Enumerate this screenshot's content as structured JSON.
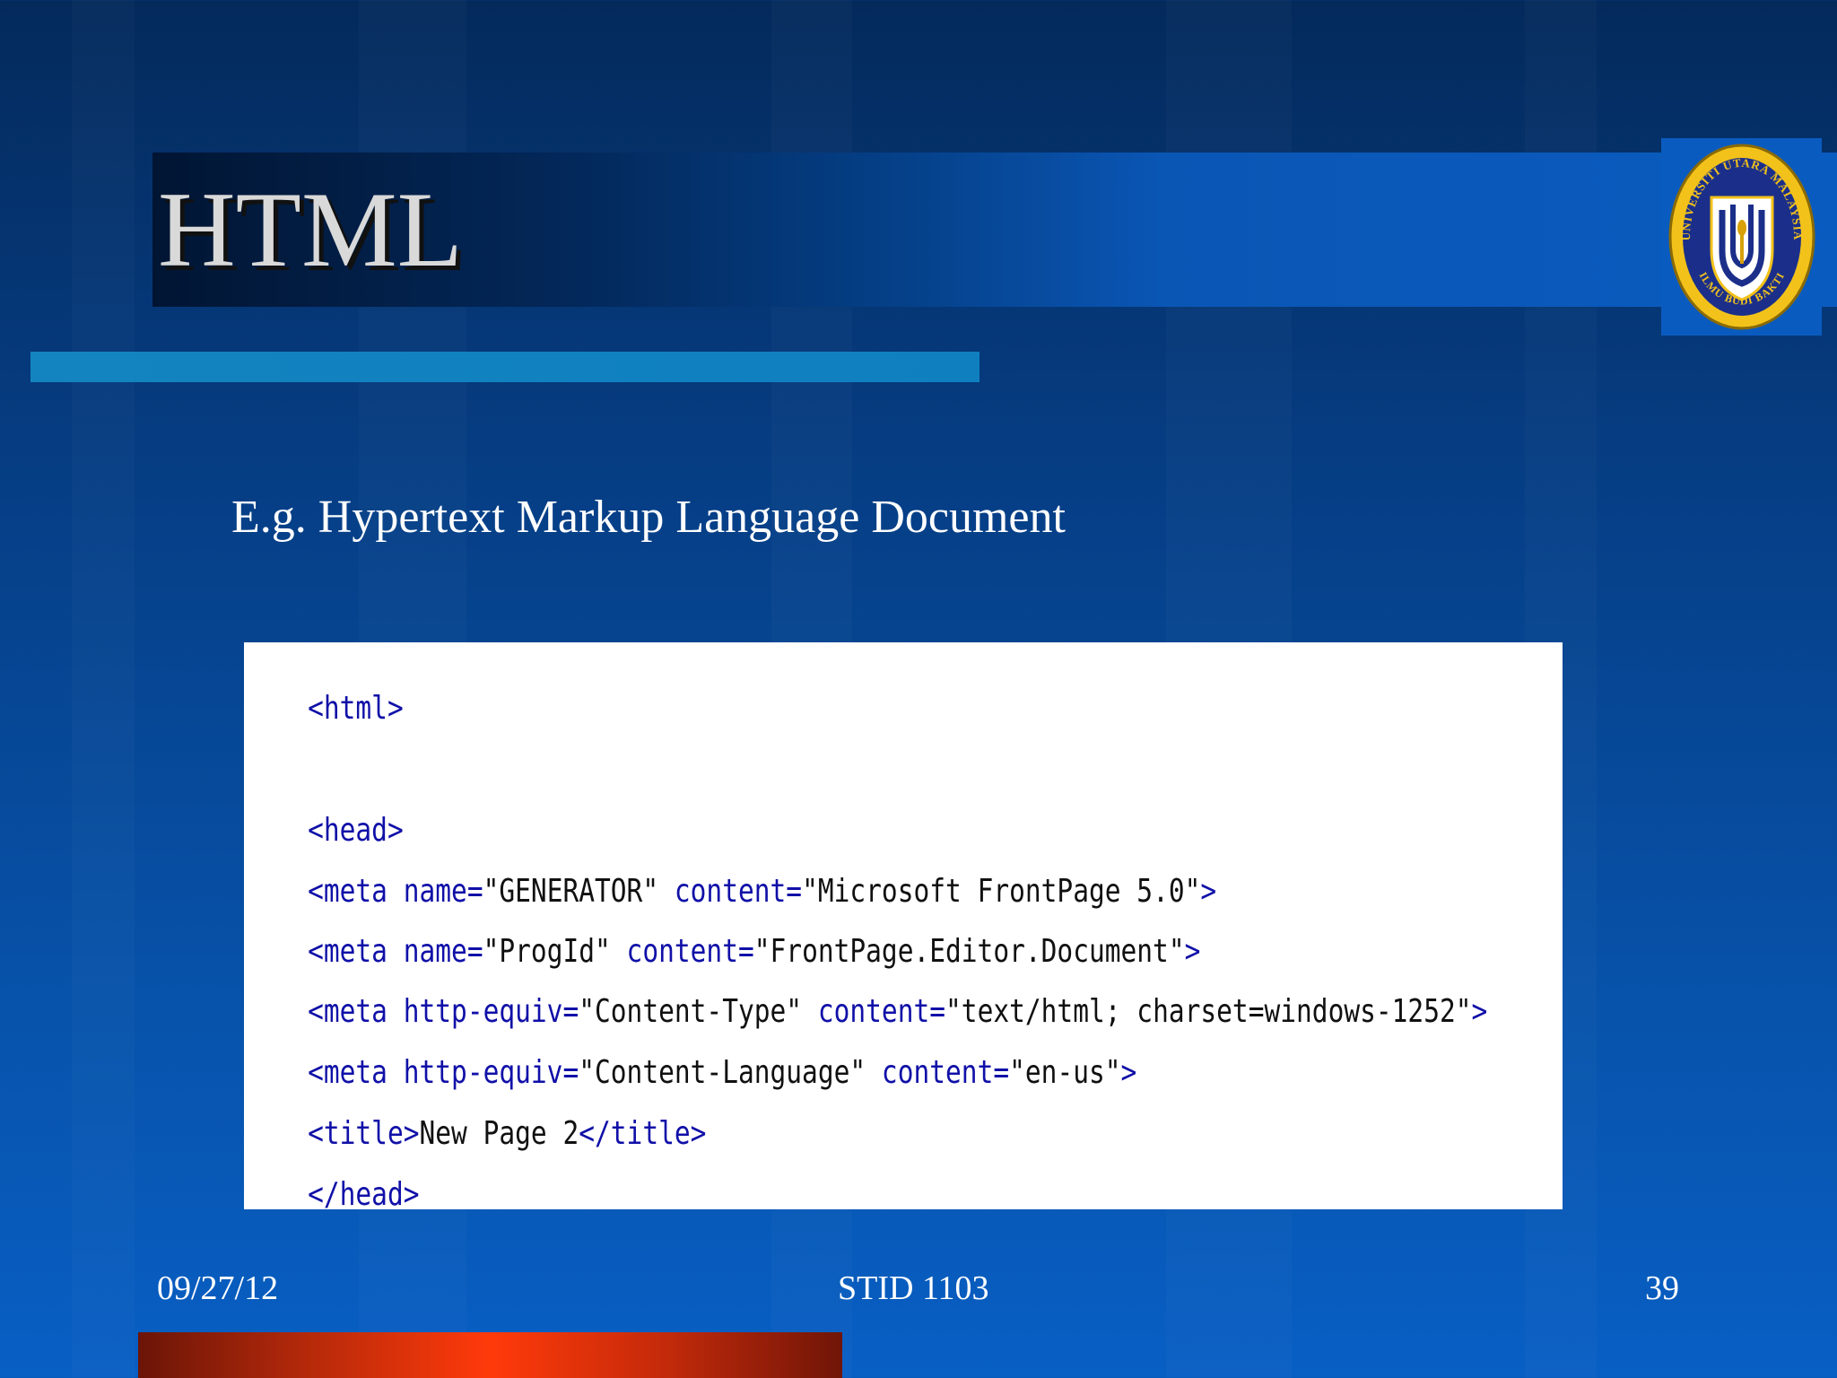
{
  "slide": {
    "title": "HTML",
    "subtitle": "E.g. Hypertext Markup Language Document"
  },
  "logo": {
    "ring_text_top": "UNIVERSITI UTARA MALAYSIA",
    "ring_text_bottom": "ILMU BUDI BAKTI"
  },
  "code_lines": [
    {
      "tag_a": "<html>",
      "str_a": "",
      "tag_b": "",
      "str_b": "",
      "tag_c": ""
    },
    {
      "tag_a": "<head>",
      "str_a": "",
      "tag_b": "",
      "str_b": "",
      "tag_c": ""
    },
    {
      "tag_a": "<meta name=",
      "str_a": "\"GENERATOR\"",
      "tag_b": " content=",
      "str_b": "\"Microsoft FrontPage 5.0\"",
      "tag_c": ">"
    },
    {
      "tag_a": "<meta name=",
      "str_a": "\"ProgId\"",
      "tag_b": " content=",
      "str_b": "\"FrontPage.Editor.Document\"",
      "tag_c": ">"
    },
    {
      "tag_a": "<meta http-equiv=",
      "str_a": "\"Content-Type\"",
      "tag_b": " content=",
      "str_b": "\"text/html; charset=windows-1252\"",
      "tag_c": ">"
    },
    {
      "tag_a": "<meta http-equiv=",
      "str_a": "\"Content-Language\"",
      "tag_b": " content=",
      "str_b": "\"en-us\"",
      "tag_c": ">"
    },
    {
      "tag_a": "<title>",
      "str_a": "New Page 2",
      "tag_b": "</title>",
      "str_b": "",
      "tag_c": ""
    },
    {
      "tag_a": "</head>",
      "str_a": "",
      "tag_b": "",
      "str_b": "",
      "tag_c": ""
    }
  ],
  "footer": {
    "date": "09/27/12",
    "course": "STID 1103",
    "page_number": "39"
  },
  "colors": {
    "code_tag": "#1010a8",
    "code_string": "#101010",
    "title_text": "#d9d9d9",
    "accent_bar": "#1384bf",
    "footer_bar": "#ff3a0a"
  }
}
